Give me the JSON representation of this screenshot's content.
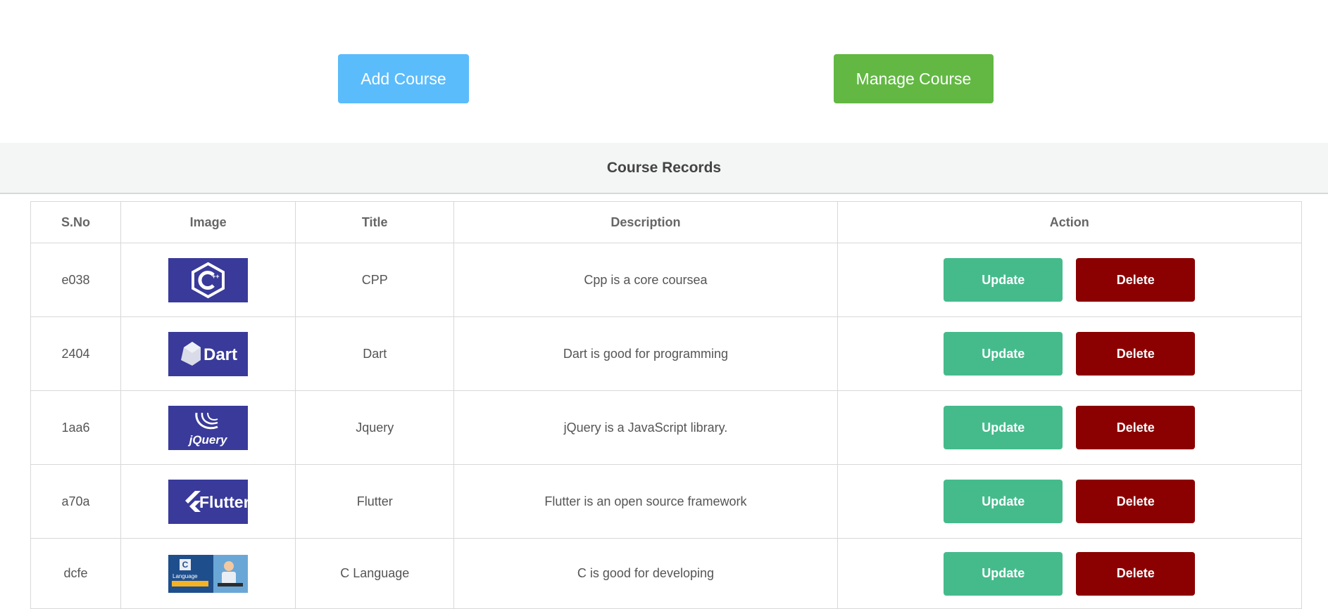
{
  "top": {
    "add_label": "Add Course",
    "manage_label": "Manage Course"
  },
  "records": {
    "title": "Course Records",
    "headers": {
      "sno": "S.No",
      "image": "Image",
      "title": "Title",
      "description": "Description",
      "action": "Action"
    },
    "rows": [
      {
        "sno": "e038",
        "image_icon": "cpp-logo-icon",
        "title": "CPP",
        "description": "Cpp is a core coursea"
      },
      {
        "sno": "2404",
        "image_icon": "dart-logo-icon",
        "title": "Dart",
        "description": "Dart is good for programming",
        "logo_text": "Dart"
      },
      {
        "sno": "1aa6",
        "image_icon": "jquery-logo-icon",
        "title": "Jquery",
        "description": "jQuery is a JavaScript library.",
        "logo_text": "jQuery"
      },
      {
        "sno": "a70a",
        "image_icon": "flutter-logo-icon",
        "title": "Flutter",
        "description": "Flutter is an open source framework",
        "logo_text": "Flutter"
      },
      {
        "sno": "dcfe",
        "image_icon": "c-language-thumbnail-icon",
        "title": "C Language",
        "description": "C is good for developing",
        "logo_text": "Language"
      }
    ],
    "update_label": "Update",
    "delete_label": "Delete"
  },
  "colors": {
    "add_button": "#5bbcfb",
    "manage_button": "#62b843",
    "update_button": "#45bb8c",
    "delete_button": "#8b0000",
    "logo_background": "#393a9a"
  }
}
